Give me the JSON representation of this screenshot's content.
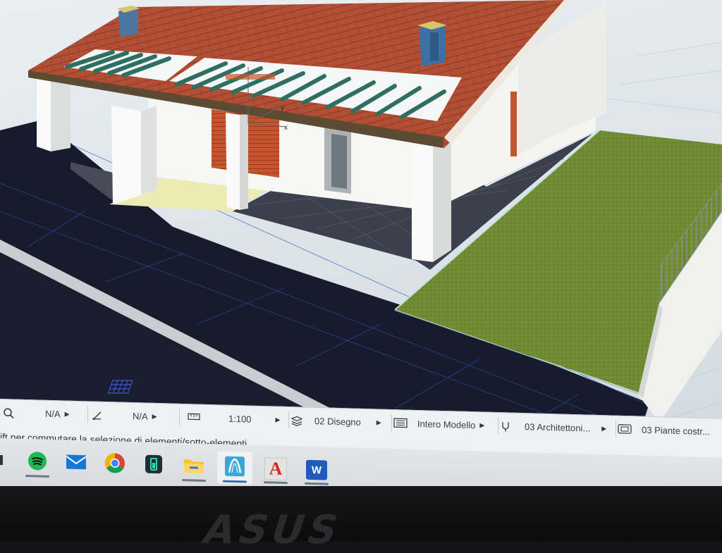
{
  "colors": {
    "roof": "#b24f34",
    "lawn": "#6e8a33",
    "road": "#191d2e",
    "wall": "#f4f4f2",
    "status_bar": "#eef0f2",
    "taskbar": "#dcdee1"
  },
  "statusbar": {
    "items": [
      {
        "icon": "zoom-icon",
        "label": "N/A"
      },
      {
        "icon": "angle-icon",
        "label": "N/A"
      },
      {
        "icon": "scale-ruler-icon",
        "label": "1:100"
      },
      {
        "icon": "layer-stack-icon",
        "label": "02 Disegno"
      },
      {
        "icon": "model-view-icon",
        "label": "Intero Modello"
      },
      {
        "icon": "pen-set-icon",
        "label": "03 Architettoni..."
      },
      {
        "icon": "dimension-icon",
        "label": "03 Piante costr..."
      }
    ],
    "hint": "ift per commutare la selezione di elementi/sotto-elementi."
  },
  "taskbar": {
    "items": [
      {
        "icon": "file-explorer-partial-icon"
      },
      {
        "icon": "spotify-icon"
      },
      {
        "icon": "mail-icon"
      },
      {
        "icon": "chrome-icon"
      },
      {
        "icon": "battery-app-icon"
      },
      {
        "icon": "folder-icon"
      },
      {
        "icon": "archicad-icon"
      },
      {
        "icon": "autocad-icon",
        "label": "A"
      },
      {
        "icon": "word-icon",
        "label": "W"
      }
    ]
  },
  "viewport": {
    "axis_y": "y",
    "axis_x": "x"
  },
  "bezel": {
    "brand": "ASUS"
  }
}
